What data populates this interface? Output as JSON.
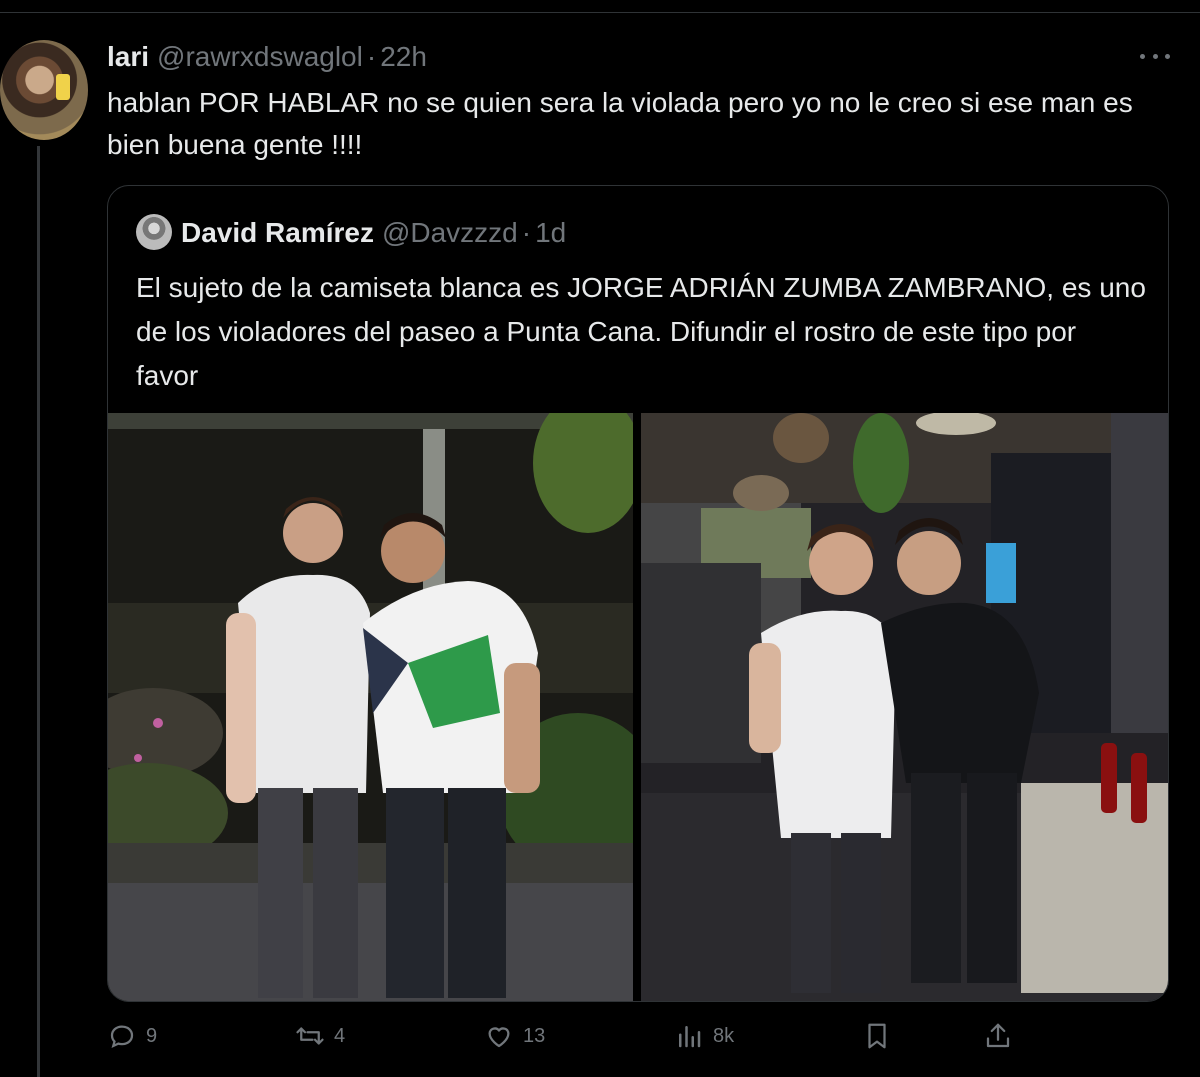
{
  "tweet": {
    "display_name": "lari",
    "handle": "@rawrxdswaglol",
    "separator": "·",
    "time": "22h",
    "text": "hablan POR HABLAR no se quien sera la violada pero yo no le creo si ese man es bien buena gente !!!!"
  },
  "quote": {
    "display_name": "David Ramírez",
    "handle": "@Davzzzd",
    "separator": "·",
    "time": "1d",
    "text": "El sujeto de la camiseta blanca es JORGE ADRIÁN ZUMBA ZAMBRANO, es uno de los violadores del paseo a Punta Cana. Difundir el rostro de este tipo por favor",
    "photos": [
      {
        "icon": "photo-two-men-outdoor-night"
      },
      {
        "icon": "photo-two-men-in-bar"
      }
    ]
  },
  "actions": {
    "replies": "9",
    "reposts": "4",
    "likes": "13",
    "views": "8k"
  },
  "colors": {
    "background": "#000000",
    "text_primary": "#e7e9ea",
    "text_secondary": "#71767b",
    "border": "#2f3336"
  }
}
